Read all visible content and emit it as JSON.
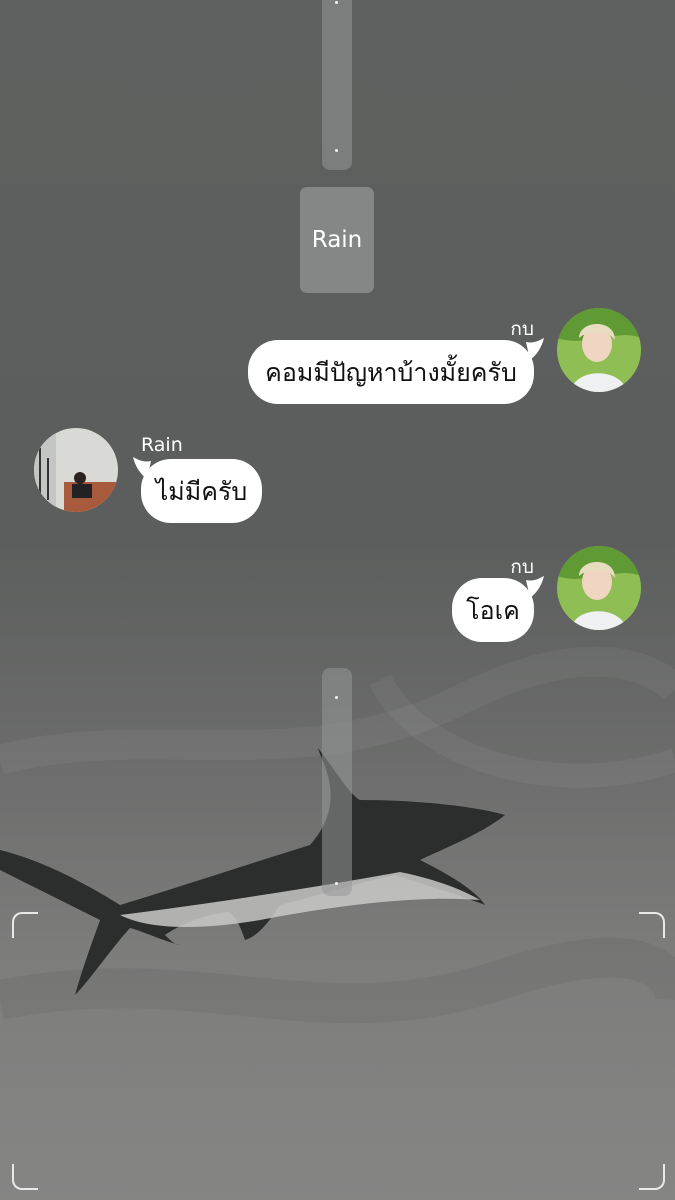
{
  "chat": {
    "contact_name": "Rain",
    "messages": [
      {
        "sender": "กบ",
        "side": "right",
        "text": "คอมมีปัญหาบ้างมั้ยครับ"
      },
      {
        "sender": "Rain",
        "side": "left",
        "text": "ไม่มีครับ"
      },
      {
        "sender": "กบ",
        "side": "right",
        "text": "โอเค"
      }
    ]
  },
  "colors": {
    "background": "#5f6160",
    "bubble": "#ffffff",
    "text_on_dark": "#ffffff"
  },
  "icons": [
    "avatar-kob",
    "avatar-rain",
    "shark-illustration",
    "viewfinder-corner"
  ]
}
